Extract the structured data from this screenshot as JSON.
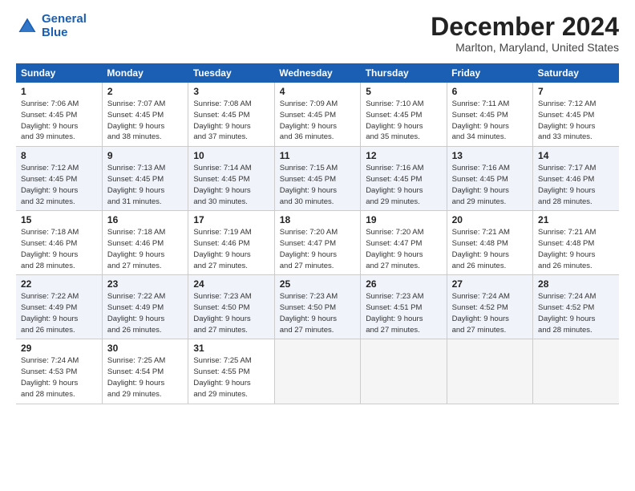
{
  "logo": {
    "line1": "General",
    "line2": "Blue"
  },
  "title": "December 2024",
  "subtitle": "Marlton, Maryland, United States",
  "days_of_week": [
    "Sunday",
    "Monday",
    "Tuesday",
    "Wednesday",
    "Thursday",
    "Friday",
    "Saturday"
  ],
  "weeks": [
    [
      {
        "num": "1",
        "rise": "7:06 AM",
        "set": "4:45 PM",
        "daylight": "9 hours and 39 minutes."
      },
      {
        "num": "2",
        "rise": "7:07 AM",
        "set": "4:45 PM",
        "daylight": "9 hours and 38 minutes."
      },
      {
        "num": "3",
        "rise": "7:08 AM",
        "set": "4:45 PM",
        "daylight": "9 hours and 37 minutes."
      },
      {
        "num": "4",
        "rise": "7:09 AM",
        "set": "4:45 PM",
        "daylight": "9 hours and 36 minutes."
      },
      {
        "num": "5",
        "rise": "7:10 AM",
        "set": "4:45 PM",
        "daylight": "9 hours and 35 minutes."
      },
      {
        "num": "6",
        "rise": "7:11 AM",
        "set": "4:45 PM",
        "daylight": "9 hours and 34 minutes."
      },
      {
        "num": "7",
        "rise": "7:12 AM",
        "set": "4:45 PM",
        "daylight": "9 hours and 33 minutes."
      }
    ],
    [
      {
        "num": "8",
        "rise": "7:12 AM",
        "set": "4:45 PM",
        "daylight": "9 hours and 32 minutes."
      },
      {
        "num": "9",
        "rise": "7:13 AM",
        "set": "4:45 PM",
        "daylight": "9 hours and 31 minutes."
      },
      {
        "num": "10",
        "rise": "7:14 AM",
        "set": "4:45 PM",
        "daylight": "9 hours and 30 minutes."
      },
      {
        "num": "11",
        "rise": "7:15 AM",
        "set": "4:45 PM",
        "daylight": "9 hours and 30 minutes."
      },
      {
        "num": "12",
        "rise": "7:16 AM",
        "set": "4:45 PM",
        "daylight": "9 hours and 29 minutes."
      },
      {
        "num": "13",
        "rise": "7:16 AM",
        "set": "4:45 PM",
        "daylight": "9 hours and 29 minutes."
      },
      {
        "num": "14",
        "rise": "7:17 AM",
        "set": "4:46 PM",
        "daylight": "9 hours and 28 minutes."
      }
    ],
    [
      {
        "num": "15",
        "rise": "7:18 AM",
        "set": "4:46 PM",
        "daylight": "9 hours and 28 minutes."
      },
      {
        "num": "16",
        "rise": "7:18 AM",
        "set": "4:46 PM",
        "daylight": "9 hours and 27 minutes."
      },
      {
        "num": "17",
        "rise": "7:19 AM",
        "set": "4:46 PM",
        "daylight": "9 hours and 27 minutes."
      },
      {
        "num": "18",
        "rise": "7:20 AM",
        "set": "4:47 PM",
        "daylight": "9 hours and 27 minutes."
      },
      {
        "num": "19",
        "rise": "7:20 AM",
        "set": "4:47 PM",
        "daylight": "9 hours and 27 minutes."
      },
      {
        "num": "20",
        "rise": "7:21 AM",
        "set": "4:48 PM",
        "daylight": "9 hours and 26 minutes."
      },
      {
        "num": "21",
        "rise": "7:21 AM",
        "set": "4:48 PM",
        "daylight": "9 hours and 26 minutes."
      }
    ],
    [
      {
        "num": "22",
        "rise": "7:22 AM",
        "set": "4:49 PM",
        "daylight": "9 hours and 26 minutes."
      },
      {
        "num": "23",
        "rise": "7:22 AM",
        "set": "4:49 PM",
        "daylight": "9 hours and 26 minutes."
      },
      {
        "num": "24",
        "rise": "7:23 AM",
        "set": "4:50 PM",
        "daylight": "9 hours and 27 minutes."
      },
      {
        "num": "25",
        "rise": "7:23 AM",
        "set": "4:50 PM",
        "daylight": "9 hours and 27 minutes."
      },
      {
        "num": "26",
        "rise": "7:23 AM",
        "set": "4:51 PM",
        "daylight": "9 hours and 27 minutes."
      },
      {
        "num": "27",
        "rise": "7:24 AM",
        "set": "4:52 PM",
        "daylight": "9 hours and 27 minutes."
      },
      {
        "num": "28",
        "rise": "7:24 AM",
        "set": "4:52 PM",
        "daylight": "9 hours and 28 minutes."
      }
    ],
    [
      {
        "num": "29",
        "rise": "7:24 AM",
        "set": "4:53 PM",
        "daylight": "9 hours and 28 minutes."
      },
      {
        "num": "30",
        "rise": "7:25 AM",
        "set": "4:54 PM",
        "daylight": "9 hours and 29 minutes."
      },
      {
        "num": "31",
        "rise": "7:25 AM",
        "set": "4:55 PM",
        "daylight": "9 hours and 29 minutes."
      },
      null,
      null,
      null,
      null
    ]
  ]
}
